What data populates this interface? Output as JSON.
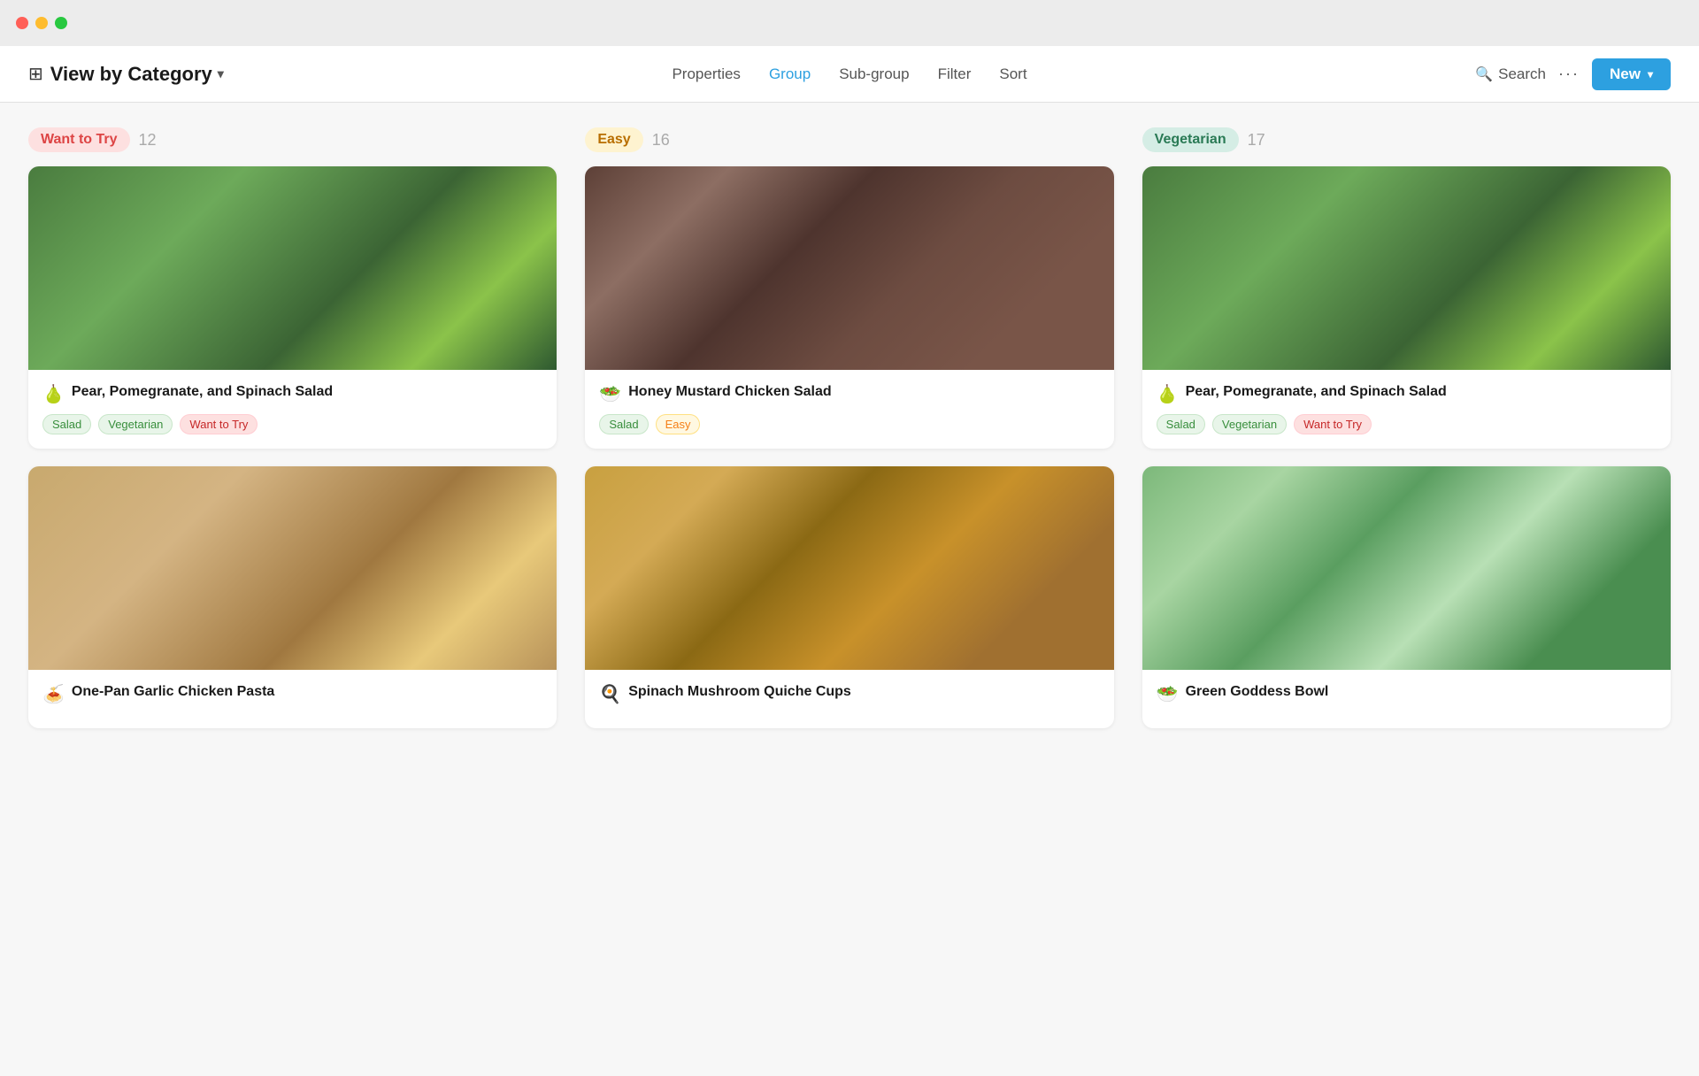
{
  "titlebar": {
    "traffic_lights": [
      "red",
      "yellow",
      "green"
    ]
  },
  "toolbar": {
    "view_icon": "⊞",
    "view_by_category": "View by Category",
    "chevron": "▾",
    "nav": [
      {
        "label": "Properties",
        "active": false
      },
      {
        "label": "Group",
        "active": true
      },
      {
        "label": "Sub-group",
        "active": false
      },
      {
        "label": "Filter",
        "active": false
      },
      {
        "label": "Sort",
        "active": false
      }
    ],
    "search_label": "Search",
    "dots": "···",
    "new_label": "New",
    "new_chevron": "▾"
  },
  "columns": [
    {
      "id": "want-to-try",
      "badge_label": "Want to Try",
      "badge_class": "badge-want",
      "count": "12",
      "cards": [
        {
          "id": "pear-pomegranate-spinach-1",
          "emoji": "🍐",
          "title": "Pear, Pomegranate, and Spinach Salad",
          "img_class": "img-spinach-salad",
          "tags": [
            {
              "label": "Salad",
              "class": "tag-salad"
            },
            {
              "label": "Vegetarian",
              "class": "tag-veg"
            },
            {
              "label": "Want to Try",
              "class": "tag-want"
            }
          ]
        },
        {
          "id": "one-pan-garlic-chicken-pasta",
          "emoji": "🍝",
          "title": "One-Pan Garlic Chicken Pasta",
          "img_class": "img-pasta",
          "tags": [],
          "partial": true
        }
      ]
    },
    {
      "id": "easy",
      "badge_label": "Easy",
      "badge_class": "badge-easy",
      "count": "16",
      "cards": [
        {
          "id": "honey-mustard-chicken-salad",
          "emoji": "🥗",
          "title": "Honey Mustard Chicken Salad",
          "img_class": "img-chicken-salad",
          "tags": [
            {
              "label": "Salad",
              "class": "tag-salad"
            },
            {
              "label": "Easy",
              "class": "tag-easy"
            }
          ]
        },
        {
          "id": "spinach-mushroom-quiche-cups",
          "emoji": "🍳",
          "title": "Spinach Mushroom Quiche Cups",
          "img_class": "img-quiche",
          "tags": [],
          "partial": true
        }
      ]
    },
    {
      "id": "vegetarian",
      "badge_label": "Vegetarian",
      "badge_class": "badge-veg",
      "count": "17",
      "cards": [
        {
          "id": "pear-pomegranate-spinach-2",
          "emoji": "🍐",
          "title": "Pear, Pomegranate, and Spinach Salad",
          "img_class": "img-spinach-salad2",
          "tags": [
            {
              "label": "Salad",
              "class": "tag-salad"
            },
            {
              "label": "Vegetarian",
              "class": "tag-veg"
            },
            {
              "label": "Want to Try",
              "class": "tag-want"
            }
          ]
        },
        {
          "id": "green-goddess-bowl",
          "emoji": "🥗",
          "title": "Green Goddess Bowl",
          "img_class": "img-green-bowl",
          "tags": [],
          "partial": true
        }
      ]
    }
  ],
  "partial_labels": {
    "one-pan-garlic-chicken-pasta": "One-Pan Garlic Chicken Pasta",
    "green-goddess-bowl": "Green Goddess Bowl"
  }
}
